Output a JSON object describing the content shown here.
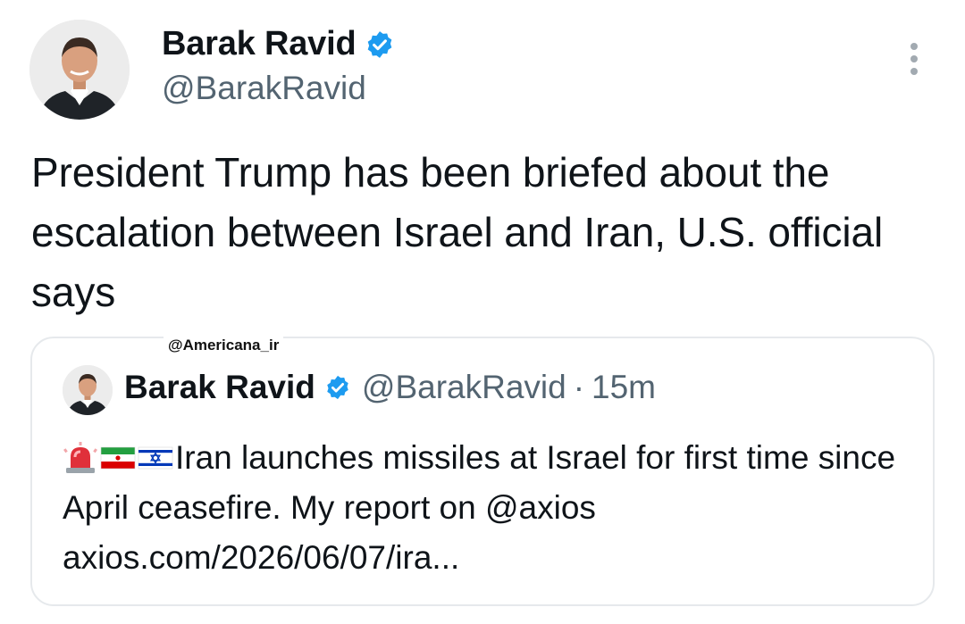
{
  "author": {
    "display_name": "Barak Ravid",
    "handle": "@BarakRavid",
    "verified_icon": "verified-badge-icon",
    "avatar_icon": "profile-photo"
  },
  "more_icon": "more-vertical-icon",
  "tweet": {
    "text": "President Trump has been briefed about the escalation between Israel and Iran, U.S. official says"
  },
  "watermark": "@Americana_ir",
  "quoted": {
    "display_name": "Barak Ravid",
    "handle": "@BarakRavid",
    "separator": "·",
    "time": "15m",
    "emojis": [
      "rotating-light-icon",
      "iran-flag-icon",
      "israel-flag-icon"
    ],
    "text": "Iran launches missiles at Israel for first time since April ceasefire. My report on @axios axios.com/2026/06/07/ira..."
  },
  "colors": {
    "verified": "#1d9bf0",
    "secondary_text": "#536471",
    "border": "#e6e9ec"
  }
}
